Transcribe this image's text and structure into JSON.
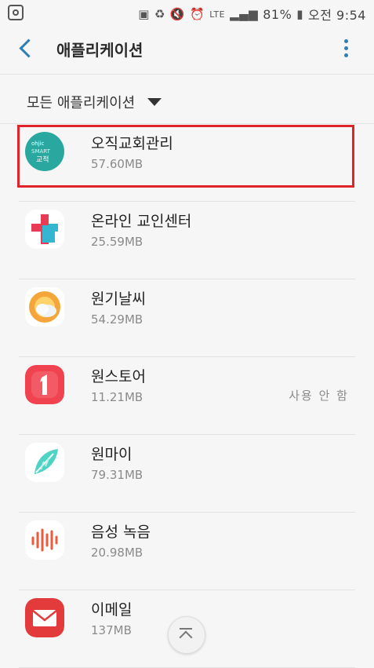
{
  "status_bar": {
    "battery": "81%",
    "time": "오전 9:54",
    "lte": "LTE"
  },
  "header": {
    "title": "애플리케이션"
  },
  "filter": {
    "label": "모든 애플리케이션"
  },
  "apps": [
    {
      "name": "오직교회관리",
      "size": "57.60MB",
      "status": "",
      "icon_text": "ohjic SMART 교적"
    },
    {
      "name": "온라인 교인센터",
      "size": "25.59MB",
      "status": ""
    },
    {
      "name": "원기날씨",
      "size": "54.29MB",
      "status": ""
    },
    {
      "name": "원스토어",
      "size": "11.21MB",
      "status": "사용 안 함"
    },
    {
      "name": "원마이",
      "size": "79.31MB",
      "status": ""
    },
    {
      "name": "음성 녹음",
      "size": "20.98MB",
      "status": ""
    },
    {
      "name": "이메일",
      "size": "137MB",
      "status": ""
    }
  ],
  "colors": {
    "accent": "#2f7fb5",
    "highlight": "#e0242b"
  }
}
